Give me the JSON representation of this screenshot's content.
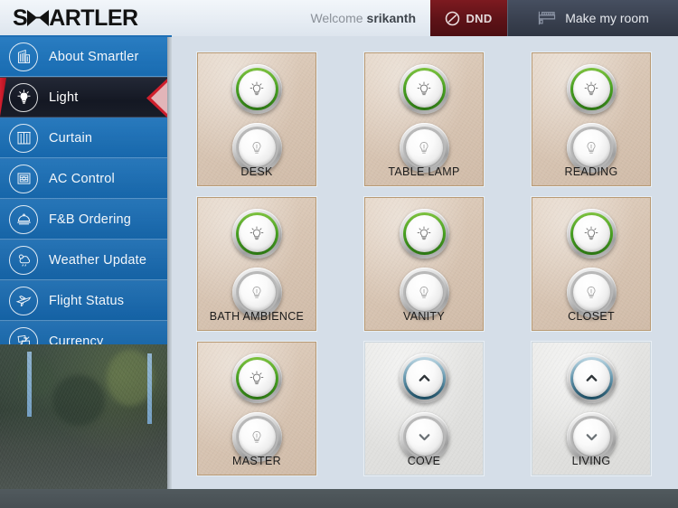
{
  "header": {
    "logo_text_1": "S",
    "logo_icon": "bowtie-m-icon",
    "logo_text_2": "ARTLER",
    "welcome_prefix": "Welcome",
    "username": "srikanth",
    "dnd_label": "DND",
    "dnd_icon": "do-not-disturb-icon",
    "dnd_color": "#5d1217",
    "make_room_label": "Make my room",
    "make_room_icon": "bed-icon",
    "accent_color": "#1f6fb5"
  },
  "sidebar": {
    "background_color": "#1668ae",
    "active_color": "#141823",
    "active_marker_color": "#c41a28",
    "items": [
      {
        "label": "About Smartler",
        "icon": "building-icon",
        "active": false
      },
      {
        "label": "Light",
        "icon": "light-bulb-icon",
        "active": true
      },
      {
        "label": "Curtain",
        "icon": "curtain-icon",
        "active": false
      },
      {
        "label": "AC Control",
        "icon": "ac-unit-icon",
        "active": false
      },
      {
        "label": "F&B Ordering",
        "icon": "food-tray-icon",
        "active": false
      },
      {
        "label": "Weather Update",
        "icon": "cloud-sun-icon",
        "active": false
      },
      {
        "label": "Flight Status",
        "icon": "airplane-icon",
        "active": false
      },
      {
        "label": "Currency",
        "icon": "currency-exchange-icon",
        "active": false
      }
    ],
    "thumbnail_alt": "garden-camera-view"
  },
  "main": {
    "background_color": "#d5dee8",
    "cards": [
      {
        "label": "DESK",
        "type": "switch",
        "style": "tan",
        "on_icon": "bulb-lit-icon",
        "off_icon": "bulb-off-icon",
        "state": "on"
      },
      {
        "label": "TABLE LAMP",
        "type": "switch",
        "style": "tan",
        "on_icon": "bulb-lit-icon",
        "off_icon": "bulb-off-icon",
        "state": "on"
      },
      {
        "label": "READING",
        "type": "switch",
        "style": "tan",
        "on_icon": "bulb-lit-icon",
        "off_icon": "bulb-off-icon",
        "state": "on"
      },
      {
        "label": "BATH AMBIENCE",
        "type": "switch",
        "style": "tan",
        "on_icon": "bulb-lit-icon",
        "off_icon": "bulb-off-icon",
        "state": "on"
      },
      {
        "label": "VANITY",
        "type": "switch",
        "style": "tan",
        "on_icon": "bulb-lit-icon",
        "off_icon": "bulb-off-icon",
        "state": "on"
      },
      {
        "label": "CLOSET",
        "type": "switch",
        "style": "tan",
        "on_icon": "bulb-lit-icon",
        "off_icon": "bulb-off-icon",
        "state": "on"
      },
      {
        "label": "MASTER",
        "type": "switch",
        "style": "tan",
        "on_icon": "bulb-lit-icon",
        "off_icon": "bulb-off-icon",
        "state": "on"
      },
      {
        "label": "COVE",
        "type": "dimmer",
        "style": "gray",
        "on_icon": "chevron-up-icon",
        "off_icon": "chevron-down-icon",
        "state": "dim"
      },
      {
        "label": "LIVING",
        "type": "dimmer",
        "style": "gray",
        "on_icon": "chevron-up-icon",
        "off_icon": "chevron-down-icon",
        "state": "dim"
      }
    ]
  },
  "footer": {
    "background_color": "#4a5256"
  }
}
